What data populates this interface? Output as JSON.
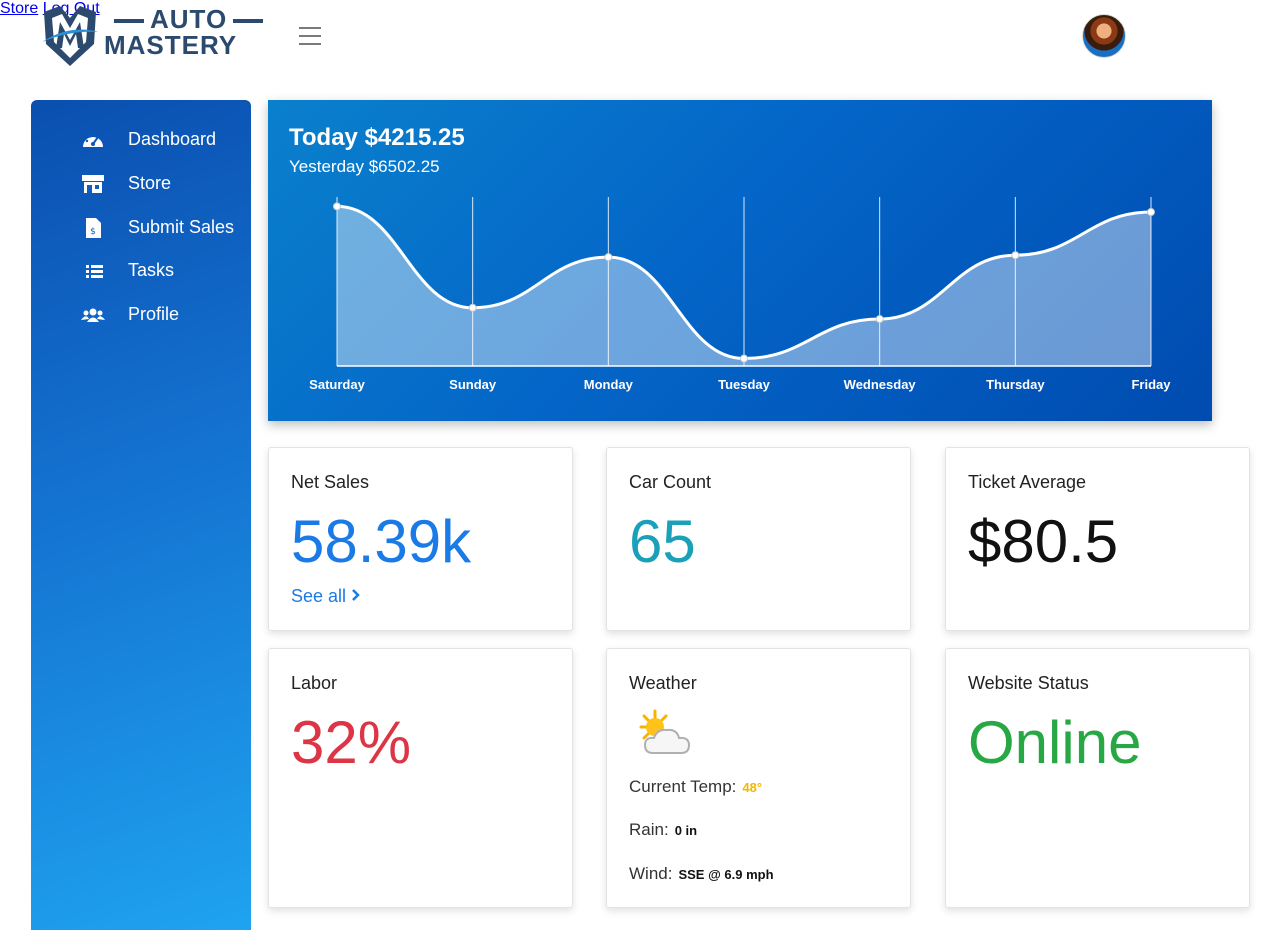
{
  "brand": {
    "line1": "AUTO",
    "line2": "MASTERY"
  },
  "nav": {
    "store": "Store",
    "logout": "Log Out"
  },
  "sidebar": {
    "items": [
      {
        "label": "Dashboard",
        "icon": "speedometer-icon"
      },
      {
        "label": "Store",
        "icon": "store-icon"
      },
      {
        "label": "Submit Sales",
        "icon": "invoice-icon"
      },
      {
        "label": "Tasks",
        "icon": "list-icon"
      },
      {
        "label": "Profile",
        "icon": "users-icon"
      }
    ]
  },
  "sales_chart": {
    "today": "Today $4215.25",
    "yesterday": "Yesterday $6502.25"
  },
  "chart_data": {
    "type": "area",
    "categories": [
      "Saturday",
      "Sunday",
      "Monday",
      "Tuesday",
      "Wednesday",
      "Thursday",
      "Friday"
    ],
    "values": [
      8500,
      3100,
      5800,
      400,
      2500,
      5900,
      8200
    ],
    "ylim": [
      0,
      9000
    ],
    "grid": true
  },
  "cards": {
    "net_sales": {
      "title": "Net Sales",
      "value": "58.39k",
      "link": "See all",
      "color": "#1a7ae6"
    },
    "car_count": {
      "title": "Car Count",
      "value": "65",
      "color": "#1aa0b8"
    },
    "ticket_avg": {
      "title": "Ticket Average",
      "value": "$80.5",
      "color": "#111111"
    },
    "labor": {
      "title": "Labor",
      "value": "32%",
      "color": "#dc3545"
    },
    "weather": {
      "title": "Weather",
      "icon": "partly-cloudy-icon",
      "temp_label": "Current Temp:",
      "temp_value": "48°",
      "rain_label": "Rain:",
      "rain_value": "0 in",
      "wind_label": "Wind:",
      "wind_value": "SSE @ 6.9 mph"
    },
    "website": {
      "title": "Website Status",
      "value": "Online",
      "color": "#28a745"
    }
  }
}
